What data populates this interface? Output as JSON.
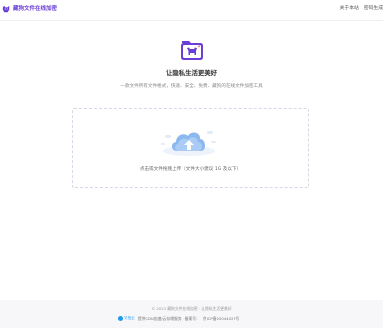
{
  "header": {
    "brand_name": "藏狗文件在线加密",
    "brand_icon": "dog-icon",
    "nav": {
      "about": "关于本站",
      "password": "密码生成"
    }
  },
  "hero": {
    "icon": "dog-folder-icon",
    "title": "让隐私生活更美好",
    "subtitle": "一款文件所有文件格式，快速、安全、免费、藏狗的在线文件加密工具"
  },
  "upload": {
    "icon": "cloud-upload-icon",
    "hint": "点击或文件拖拽上传（文件大小建议 1G 及以下）"
  },
  "footer": {
    "copyright": "© 2023 藏狗文件在线加密 · 让隐私生活更美好",
    "cdn_logo_text": "又拍云",
    "cdn_text": "提供CDN加速/云存储服务",
    "icp_label": "备案号：",
    "icp_number": "京ICP备2004402?号"
  },
  "colors": {
    "brand": "#6a3fd6",
    "cloud": "#7fb0ee",
    "cloud_light": "#dfe9f8",
    "cdn_blue": "#1e9bf0"
  }
}
